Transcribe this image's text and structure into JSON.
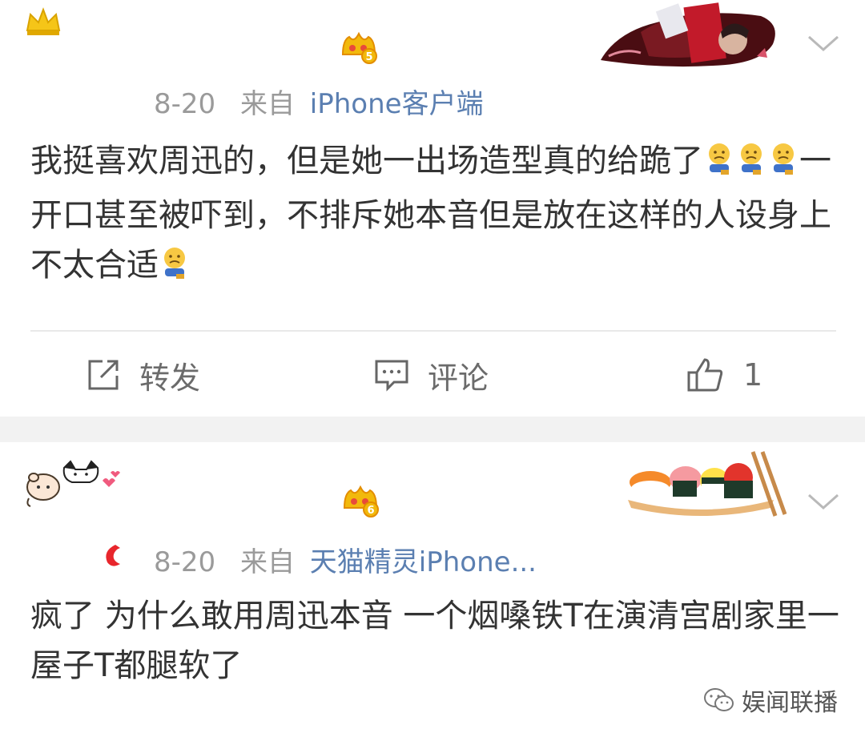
{
  "post1": {
    "date": "8-20",
    "from_label": "来自",
    "source": "iPhone客户端",
    "text_parts": [
      "我挺喜欢周迅的，但是她一出场造型真的给跪了",
      "一开口甚至被吓到，不排斥她本音但是放在这样的人设身上不太合适"
    ],
    "crown_level": "5",
    "emoji": "sad-face-emoji",
    "actions": {
      "repost_label": "转发",
      "comment_label": "评论",
      "like_count": "1"
    }
  },
  "post2": {
    "date": "8-20",
    "from_label": "来自",
    "source": "天猫精灵iPhone...",
    "text": "疯了 为什么敢用周迅本音 一个烟嗓铁T在演清宫剧家里一屋子T都腿软了",
    "crown_level": "6"
  },
  "watermark": {
    "text": "娱闻联播"
  },
  "colors": {
    "source_link": "#5b7fb1",
    "meta_gray": "#9a9a9a",
    "crown_gold": "#f2b90c",
    "separator": "#f2f2f2"
  }
}
